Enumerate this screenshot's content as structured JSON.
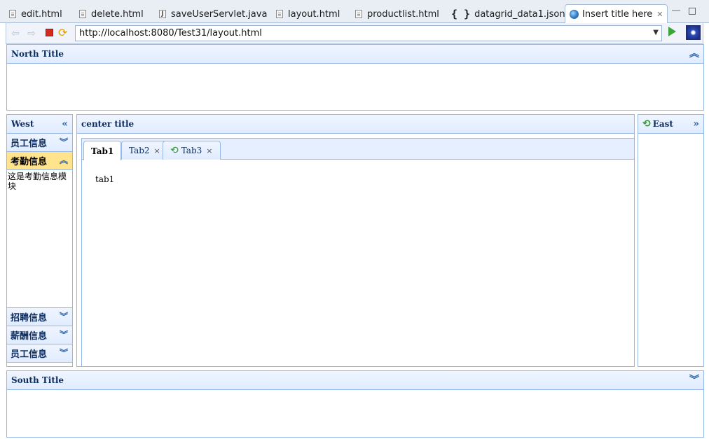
{
  "editor_tabs": [
    {
      "label": "edit.html",
      "icon": "html-file-icon"
    },
    {
      "label": "delete.html",
      "icon": "html-file-icon"
    },
    {
      "label": "saveUserServlet.java",
      "icon": "java-file-icon"
    },
    {
      "label": "layout.html",
      "icon": "html-file-icon"
    },
    {
      "label": "productlist.html",
      "icon": "html-file-icon"
    },
    {
      "label": "datagrid_data1.json",
      "icon": "json-file-icon"
    },
    {
      "label": "Insert title here",
      "icon": "globe-icon",
      "active": true
    }
  ],
  "toolbar": {
    "url": "http://localhost:8080/Test31/layout.html"
  },
  "layout": {
    "north": {
      "title": "North Title"
    },
    "south": {
      "title": "South Title"
    },
    "west": {
      "title": "West",
      "accordion": [
        {
          "title": "员工信息"
        },
        {
          "title": "考勤信息",
          "selected": true,
          "body": "这是考勤信息模块"
        },
        {
          "title": "招聘信息"
        },
        {
          "title": "薪酬信息"
        },
        {
          "title": "员工信息"
        }
      ]
    },
    "center": {
      "title": "center title",
      "tabs": [
        {
          "label": "Tab1"
        },
        {
          "label": "Tab2"
        },
        {
          "label": "Tab3"
        }
      ],
      "active_tab_content": "tab1"
    },
    "east": {
      "title": "East"
    }
  },
  "colors": {
    "panel_border": "#95b8e7",
    "header_bg": "#e0ecff",
    "selected_accordion": "#ffe48d"
  }
}
